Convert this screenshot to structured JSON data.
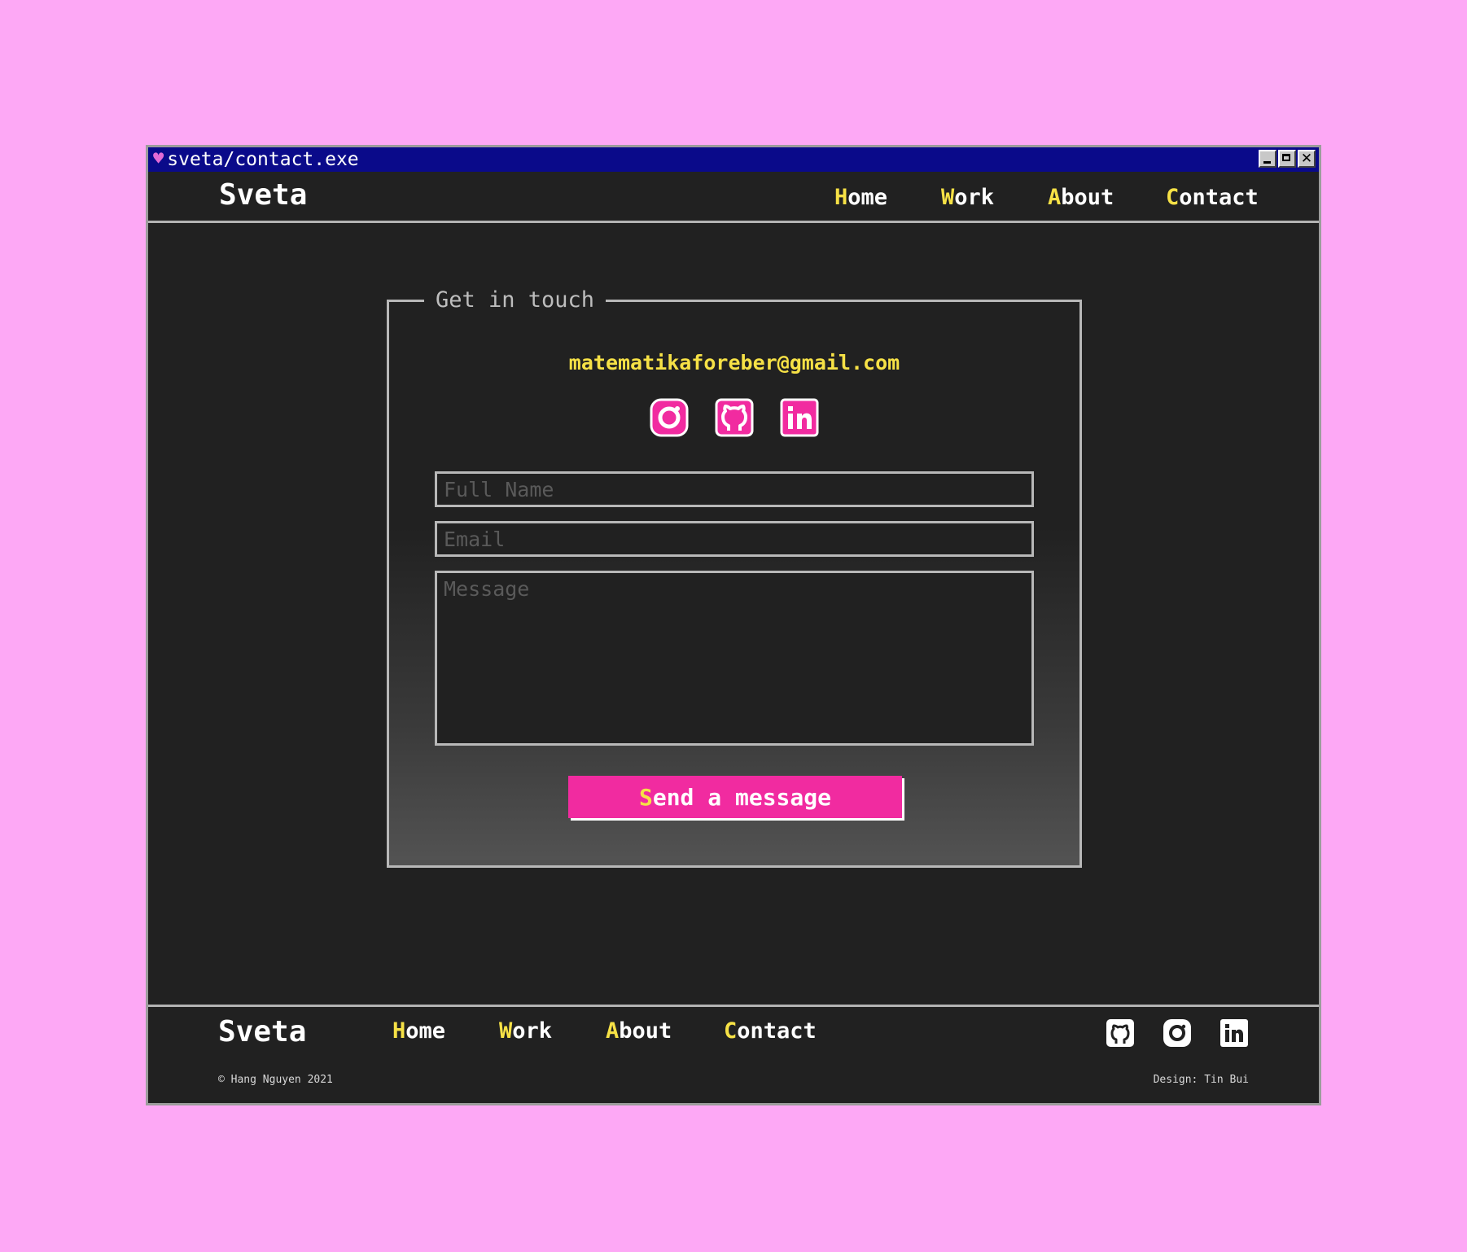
{
  "window": {
    "title": "sveta/contact.exe",
    "heart_icon": "heart-icon",
    "controls": [
      "minimize-icon",
      "maximize-icon",
      "close-icon"
    ],
    "close_glyph": "✕"
  },
  "header": {
    "brand": "Sveta",
    "nav": [
      {
        "label": "Home"
      },
      {
        "label": "Work"
      },
      {
        "label": "About"
      },
      {
        "label": "Contact"
      }
    ]
  },
  "contact": {
    "legend": "Get in touch",
    "email": "matematikaforeber@gmail.com",
    "social_icons": [
      "instagram-icon",
      "github-icon",
      "linkedin-icon"
    ],
    "form": {
      "name_placeholder": "Full Name",
      "email_placeholder": "Email",
      "message_placeholder": "Message",
      "submit_first": "S",
      "submit_rest": "end a message"
    }
  },
  "footer": {
    "brand": "Sveta",
    "nav": [
      {
        "label": "Home"
      },
      {
        "label": "Work"
      },
      {
        "label": "About"
      },
      {
        "label": "Contact"
      }
    ],
    "social_icons": [
      "github-icon",
      "instagram-icon",
      "linkedin-icon"
    ],
    "copyright": "© Hang Nguyen 2021",
    "design_credit": "Design: Tin Bui"
  },
  "colors": {
    "page_background": "#fda8f5",
    "window_background": "#212121",
    "titlebar": "#0a0a8a",
    "accent_pink": "#f12ba0",
    "accent_yellow": "#f6e146",
    "heart": "#e36ad6"
  }
}
